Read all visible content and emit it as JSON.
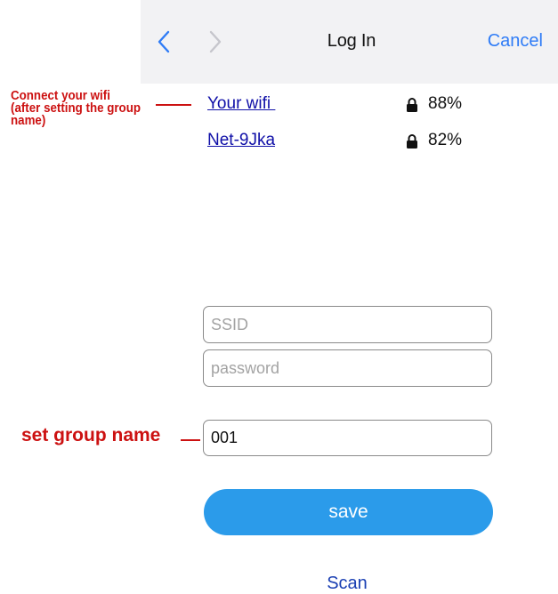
{
  "navbar": {
    "back_icon": "chevron-left-icon",
    "forward_icon": "chevron-right-icon",
    "title": "Log In",
    "cancel_label": "Cancel",
    "accent_color": "#2f7cf6"
  },
  "wifi_list": [
    {
      "name": "Your wifi ",
      "lock_icon": "lock-icon",
      "signal": "88%"
    },
    {
      "name": "Net-9Jka",
      "lock_icon": "lock-icon",
      "signal": "82%"
    }
  ],
  "annotations": {
    "wifi_note": "Connect your wifi (after setting the group name)",
    "group_note": "set group name",
    "color": "#cc1111"
  },
  "form": {
    "ssid_placeholder": "SSID",
    "password_placeholder": "password",
    "group_value": "001"
  },
  "save_label": "save",
  "scan_label": "Scan",
  "save_color": "#2b9bea"
}
